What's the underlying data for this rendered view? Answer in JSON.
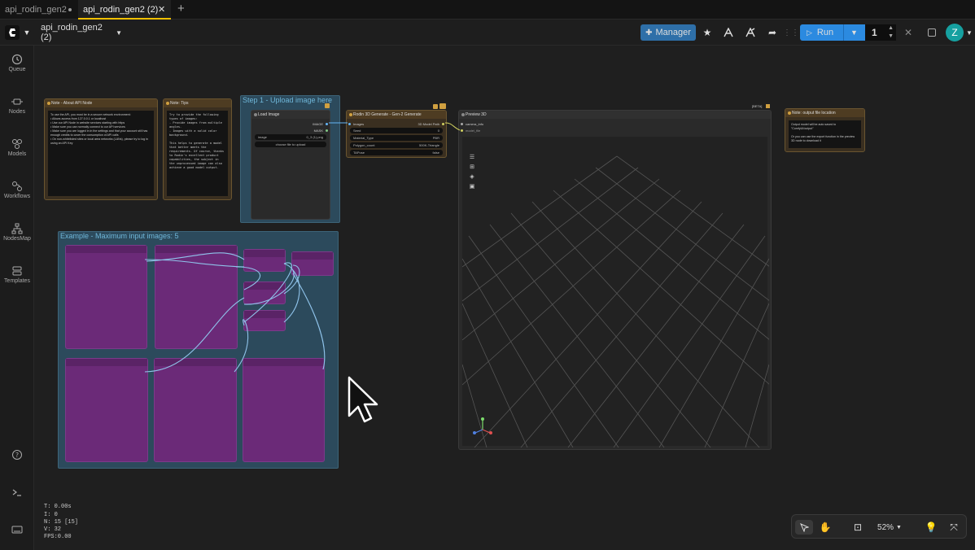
{
  "tabs": [
    {
      "label": "api_rodin_gen2",
      "active": false
    },
    {
      "label": "api_rodin_gen2 (2)",
      "active": true
    }
  ],
  "toolbar": {
    "workflow_name": "api_rodin_gen2 (2)",
    "manager_label": "Manager",
    "run_label": "Run",
    "queue_count": "1",
    "avatar_letter": "Z"
  },
  "sidebar": [
    {
      "label": "Queue",
      "icon": "history-icon"
    },
    {
      "label": "Nodes",
      "icon": "nodes-icon"
    },
    {
      "label": "Models",
      "icon": "cube-icon"
    },
    {
      "label": "Workflows",
      "icon": "workflow-icon"
    },
    {
      "label": "NodesMap",
      "icon": "sitemap-icon"
    },
    {
      "label": "Templates",
      "icon": "templates-icon"
    }
  ],
  "nodes": {
    "note_api": {
      "title": "Note - About API Node",
      "body": "To use the API, you must be in a secure network environment:\n• Allows access from 127.0.0.1 or localhost\n• Use our API Node in website services starting with https\n• Make sure you can normally connect to our API services\n• Make sure you are logged in in the settings and that your account still has enough credits to cover the consumption of API calls\n• On non-whitelisted sites or local area networks (LANs), please try to log in using an API Key"
    },
    "note_tips": {
      "title": "Note: Tips",
      "body": "Try to provide the following types of images:\n- Provide images from multiple angles.\n- Images with a solid color background.\n\nThis helps to generate a model that better meets the requirements. Of course, thanks to Rodin's excellent product capabilities, the subject in the unprocessed image can also achieve a good model output."
    },
    "group_upload": {
      "title": "Step 1 - Upload image here"
    },
    "load_image": {
      "title": "Load Image",
      "out_image": "IMAGE",
      "out_mask": "MASK",
      "image_label": "image",
      "image_value": "0_3 (1).png",
      "upload_label": "choose file to upload"
    },
    "rodin": {
      "title": "Rodin 3D Generate - Gen-2 Generate",
      "in_images": "Images",
      "out_label": "3D Model Path",
      "seed_label": "Seed",
      "seed_value": "0",
      "material_label": "Material_Type",
      "material_value": "PBR",
      "polygon_label": "Polygon_count",
      "polygon_value": "500K-Triangle",
      "tapose_label": "TAPose",
      "tapose_value": "false"
    },
    "preview": {
      "title": "Preview 3D",
      "beta": "[BETA]",
      "in_camera": "camera_info",
      "in_model": "model_file"
    },
    "note_output": {
      "title": "Note: output file location",
      "body": "Output model will be auto saved to \"ComfyUI/output\"\n\nOr you can use the export function in the preview 3D node to download it"
    },
    "group_example": {
      "title": "Example - Maximum input images: 5"
    }
  },
  "stats": {
    "t": "T: 0.00s",
    "i": "I: 0",
    "n": "N: 15 [15]",
    "v": "V: 32",
    "fps": "FPS:0.00"
  },
  "zoom": {
    "value": "52%"
  }
}
